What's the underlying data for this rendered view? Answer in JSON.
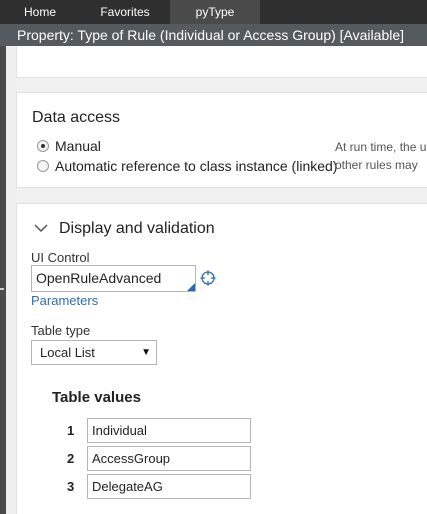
{
  "tabs": [
    {
      "label": "Home"
    },
    {
      "label": "Favorites"
    },
    {
      "label": "pyType"
    }
  ],
  "header": {
    "title": "Property:  Type of Rule (Individual or Access Group) [Available]"
  },
  "data_access": {
    "title": "Data access",
    "options": [
      {
        "label": "Manual",
        "selected": true
      },
      {
        "label": "Automatic reference to class instance (linked)",
        "selected": false
      }
    ],
    "hint_lines": [
      "At run time, the u",
      "other rules may"
    ]
  },
  "display_validation": {
    "title": "Display and validation",
    "ui_control_label": "UI Control",
    "ui_control_value": "OpenRuleAdvanced",
    "parameters_link": "Parameters",
    "table_type_label": "Table type",
    "table_type_value": "Local List",
    "table_values_title": "Table values",
    "table_values": [
      {
        "index": "1",
        "value": "Individual"
      },
      {
        "index": "2",
        "value": "AccessGroup"
      },
      {
        "index": "3",
        "value": "DelegateAG"
      }
    ]
  },
  "colors": {
    "topbar": "#2f2f2f",
    "titlebar": "#555a5f",
    "link": "#2e6cb5",
    "accent": "#1a6cc0"
  }
}
